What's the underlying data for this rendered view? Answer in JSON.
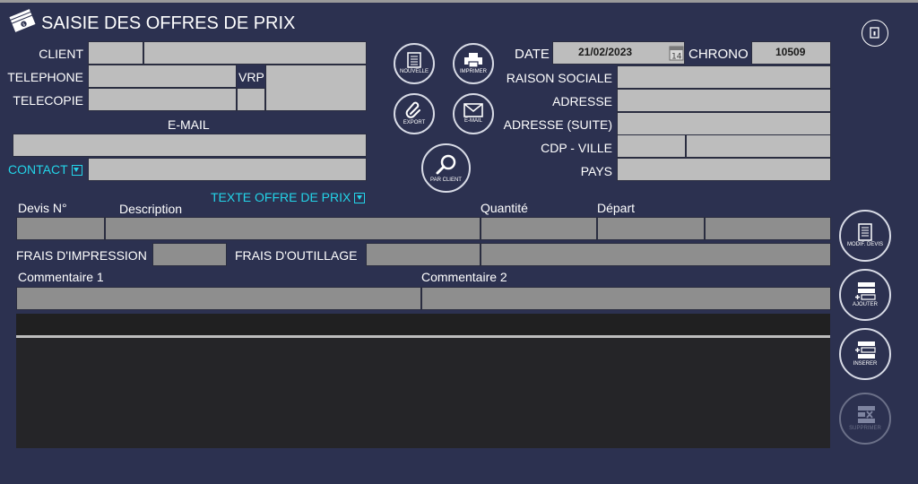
{
  "header": {
    "title": "SAISIE DES OFFRES DE PRIX"
  },
  "labels": {
    "client": "CLIENT",
    "telephone": "TELEPHONE",
    "vrp": "VRP",
    "telecopie": "TELECOPIE",
    "email": "E-MAIL",
    "contact": "CONTACT",
    "date": "DATE",
    "chrono": "CHRONO",
    "raison_sociale": "RAISON SOCIALE",
    "adresse": "ADRESSE",
    "adresse_suite": "ADRESSE (SUITE)",
    "cdp_ville": "CDP - VILLE",
    "pays": "PAYS",
    "texte_offre": "TEXTE OFFRE DE PRIX",
    "devis_no": "Devis N°",
    "description": "Description",
    "quantite": "Quantité",
    "depart": "Départ",
    "frais_impression": "FRAIS D'IMPRESSION",
    "frais_outillage": "FRAIS D'OUTILLAGE",
    "commentaire1": "Commentaire 1",
    "commentaire2": "Commentaire 2"
  },
  "values": {
    "date": "21/02/2023",
    "chrono": "10509"
  },
  "buttons": {
    "nouvelle": "NOUVELLE",
    "imprimer": "IMPRIMER",
    "export": "EXPORT",
    "email": "E-MAIL",
    "par_client": "PAR CLIENT",
    "modif_devis": "MODIF. DEVIS",
    "ajouter": "AJOUTER",
    "inserer": "INSERER",
    "supprimer": "SUPPRIMER"
  },
  "colors": {
    "background": "#2c3150",
    "field": "#bdbdbd",
    "accent": "#23d4e8"
  },
  "icons": {
    "title": "money-bills-icon",
    "close": "exit-icon",
    "calendar": "calendar-icon"
  }
}
